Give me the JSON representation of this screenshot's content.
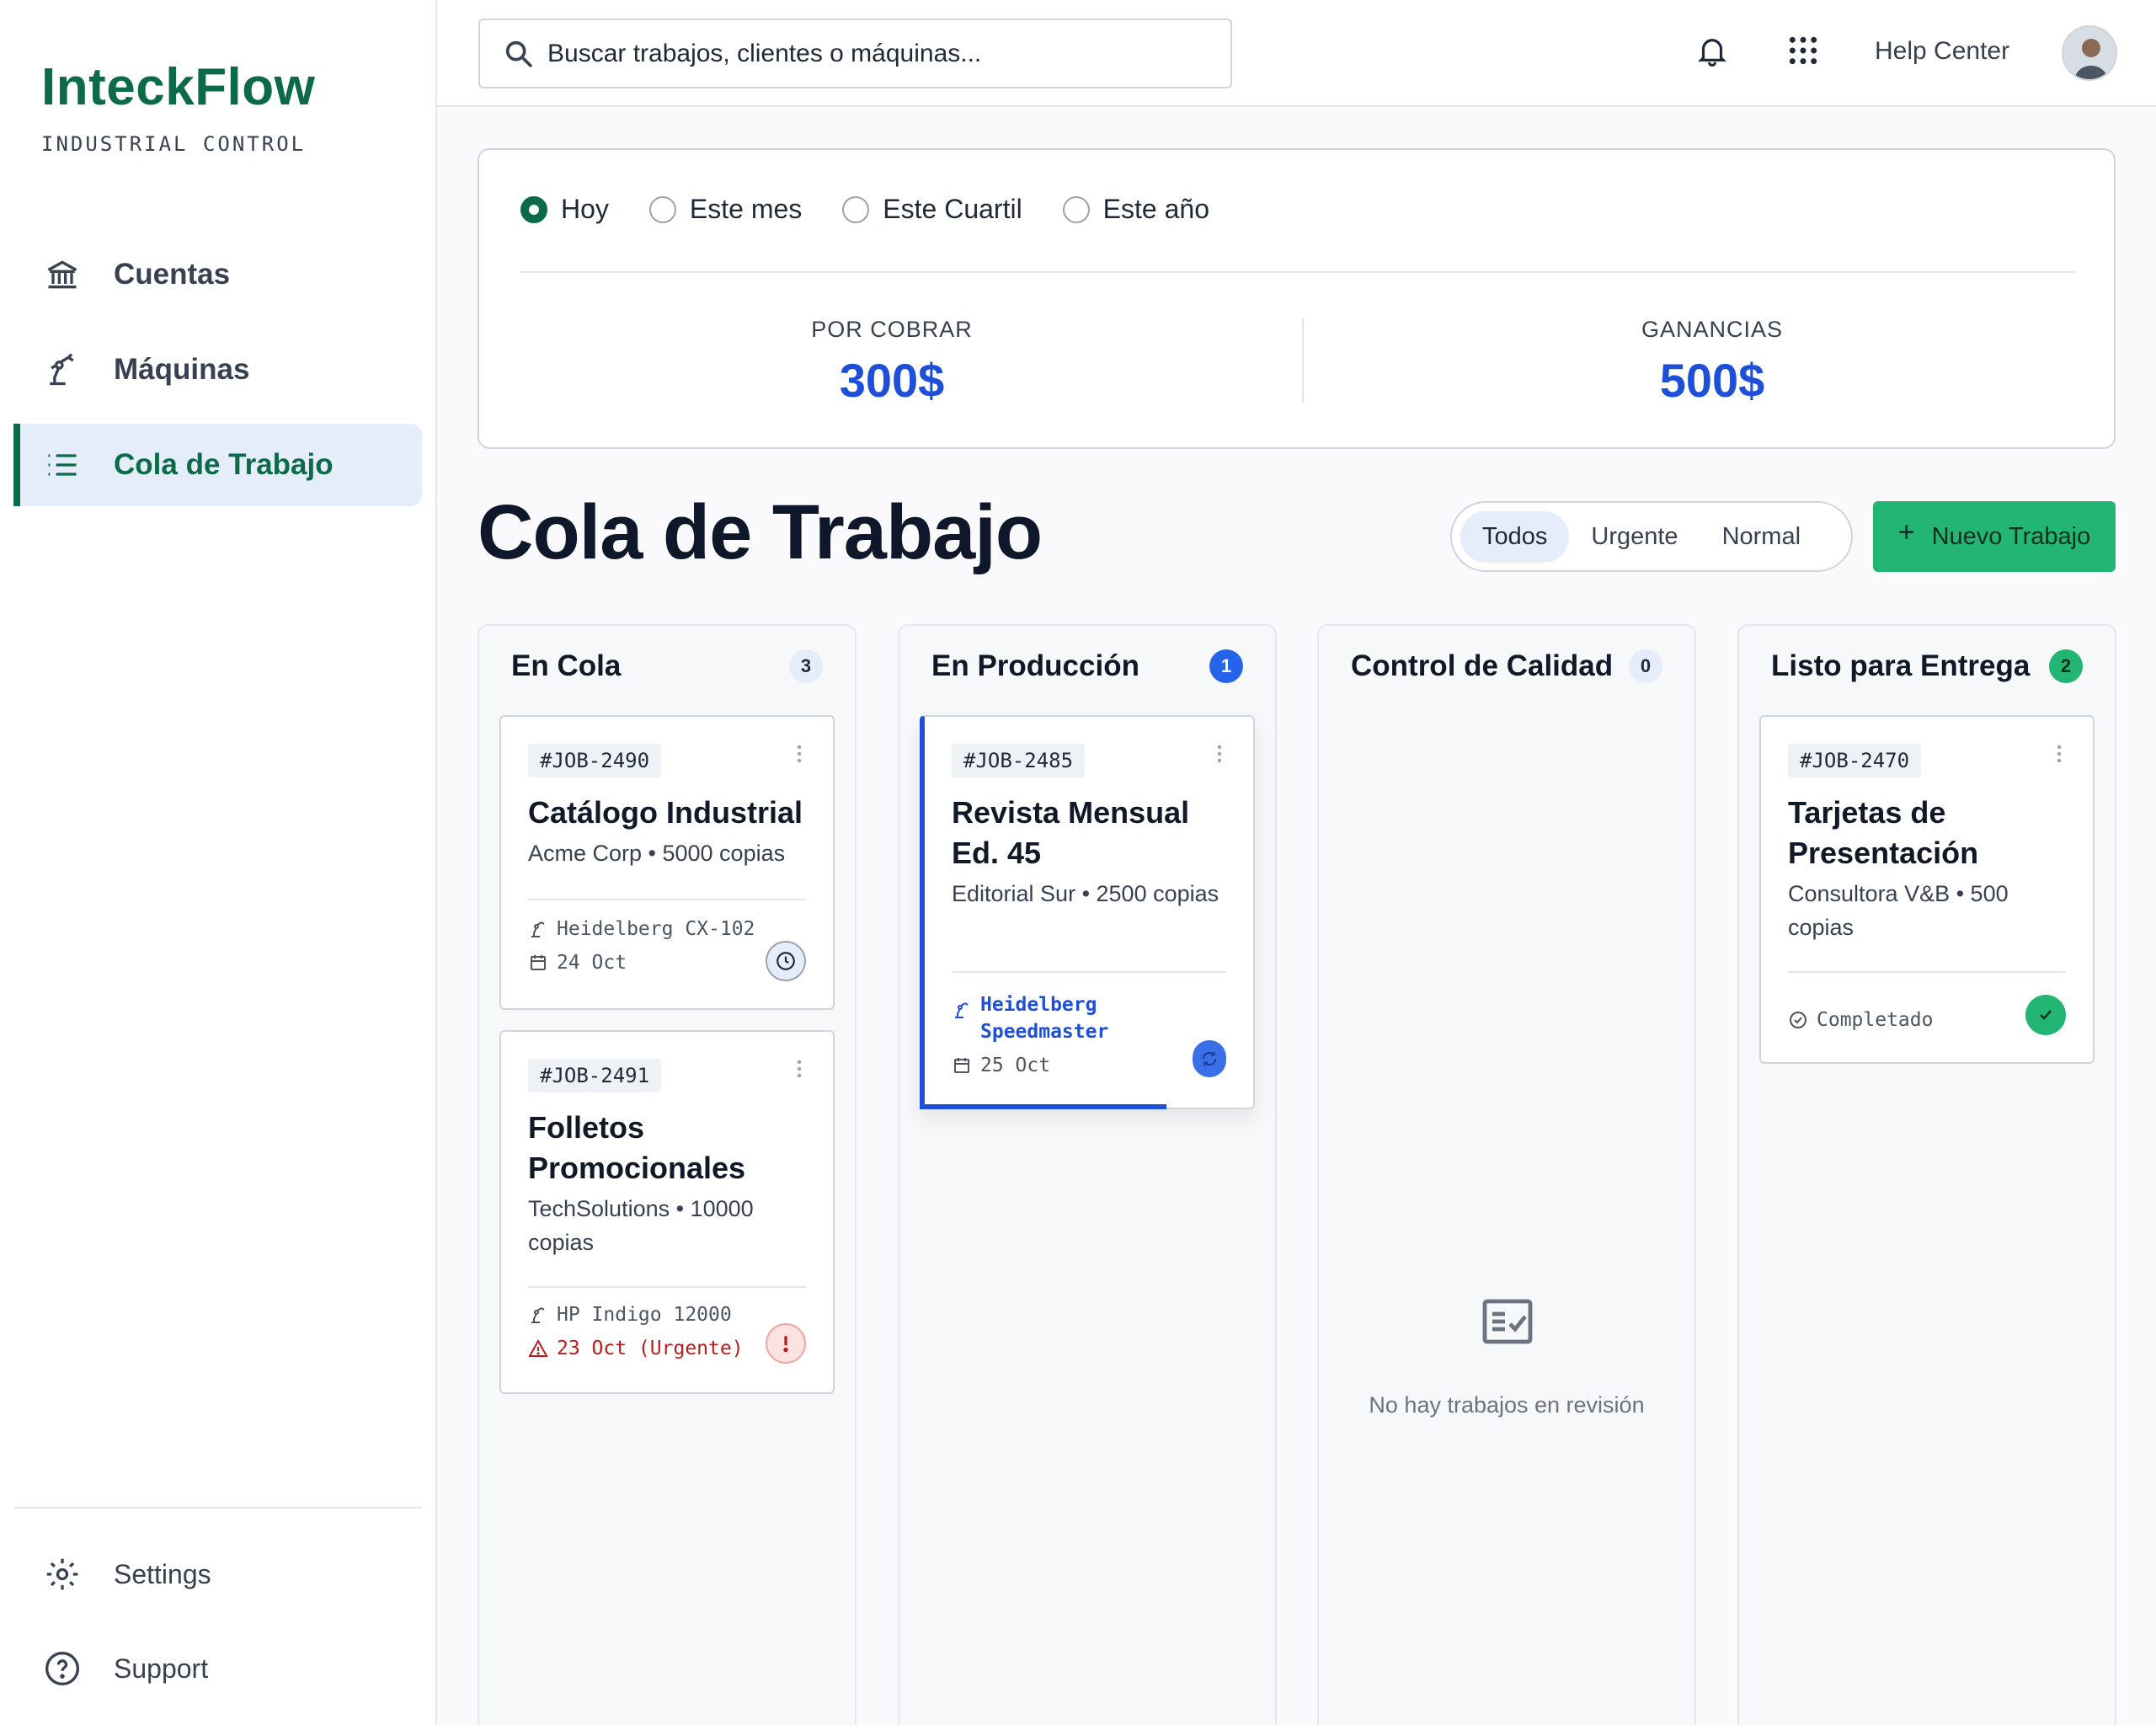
{
  "brand": {
    "title": "InteckFlow",
    "subtitle": "INDUSTRIAL CONTROL"
  },
  "sidebar": {
    "items": [
      {
        "label": "Cuentas",
        "icon": "bank-icon"
      },
      {
        "label": "Máquinas",
        "icon": "robot-arm-icon"
      },
      {
        "label": "Cola de Trabajo",
        "icon": "list-icon",
        "active": true
      }
    ],
    "footer": [
      {
        "label": "Settings",
        "icon": "gear-icon"
      },
      {
        "label": "Support",
        "icon": "help-circle-icon"
      }
    ]
  },
  "topbar": {
    "search_placeholder": "Buscar trabajos, clientes o máquinas...",
    "help": "Help Center"
  },
  "periods": {
    "options": [
      "Hoy",
      "Este mes",
      "Este Cuartil",
      "Este año"
    ],
    "selected": "Hoy"
  },
  "stats": {
    "receivable_label": "POR COBRAR",
    "receivable_value": "300$",
    "earnings_label": "GANANCIAS",
    "earnings_value": "500$"
  },
  "page": {
    "title": "Cola de Trabajo",
    "filters": [
      "Todos",
      "Urgente",
      "Normal"
    ],
    "filter_selected": "Todos",
    "new_button": "Nuevo Trabajo"
  },
  "colors": {
    "brand": "#0b6b47",
    "accent_blue": "#1d4fd8",
    "success": "#22b573",
    "urgent": "#b91c1c"
  },
  "columns": [
    {
      "title": "En Cola",
      "count": "3",
      "cards": [
        {
          "id": "#JOB-2490",
          "title": "Catálogo Industrial",
          "subtitle": "Acme Corp • 5000 copias",
          "machine": "Heidelberg CX-102",
          "date": "24 Oct",
          "status": "clock-icon"
        },
        {
          "id": "#JOB-2491",
          "title": "Folletos Promocionales",
          "subtitle": "TechSolutions • 10000 copias",
          "machine": "HP Indigo 12000",
          "date": "23 Oct (Urgente)",
          "status": "alert-icon"
        }
      ]
    },
    {
      "title": "En Producción",
      "count": "1",
      "cards": [
        {
          "id": "#JOB-2485",
          "title": "Revista Mensual Ed. 45",
          "subtitle": "Editorial Sur • 2500 copias",
          "machine": "Heidelberg Speedmaster",
          "date": "25 Oct",
          "status": "sync-icon",
          "progress": 0.75
        }
      ]
    },
    {
      "title": "Control de Calidad",
      "count": "0",
      "empty_text": "No hay trabajos en revisión"
    },
    {
      "title": "Listo para Entrega",
      "count": "2",
      "cards": [
        {
          "id": "#JOB-2470",
          "title": "Tarjetas de Presentación",
          "subtitle": "Consultora V&B • 500 copias",
          "state": "Completado",
          "status": "check-icon"
        }
      ]
    }
  ]
}
